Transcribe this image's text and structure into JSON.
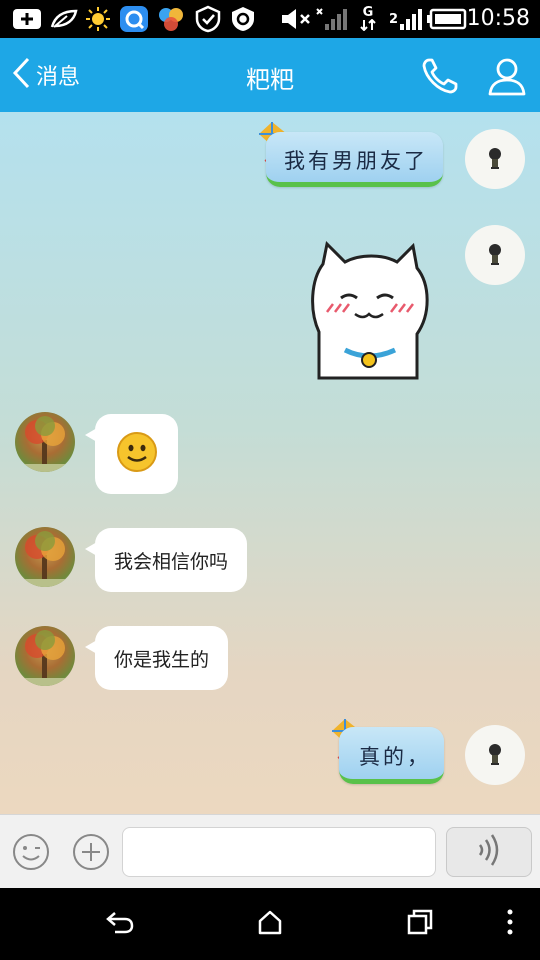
{
  "status_bar": {
    "time": "10:58",
    "network_label": "G",
    "sim_label": "2",
    "icons": [
      "add-icon",
      "leaf-icon",
      "sun-icon",
      "qq-browser-icon",
      "qq-color-icon",
      "shield-icon",
      "settings-shield-icon",
      "volume-mute-icon",
      "signal-icon",
      "data-icon",
      "signal-2-icon",
      "battery-icon"
    ]
  },
  "header": {
    "back_label": "消息",
    "title": "粑粑",
    "icons": {
      "back": "chevron-left-icon",
      "phone": "phone-icon",
      "profile": "person-icon"
    }
  },
  "messages": [
    {
      "side": "right",
      "type": "kite-text",
      "text": "我有男朋友了"
    },
    {
      "side": "right",
      "type": "sticker",
      "sticker": "cat-blush-sticker"
    },
    {
      "side": "left",
      "type": "emoji",
      "emoji": "smile-emoji"
    },
    {
      "side": "left",
      "type": "text",
      "text": "我会相信你吗"
    },
    {
      "side": "left",
      "type": "text",
      "text": "你是我生的"
    },
    {
      "side": "right",
      "type": "kite-text",
      "text": "真的，"
    }
  ],
  "input_bar": {
    "placeholder": "",
    "icons": {
      "emoji": "emoji-icon",
      "plus": "plus-icon",
      "voice": "voice-icon"
    }
  },
  "nav_bar": {
    "icons": [
      "back-icon",
      "home-icon",
      "recents-icon",
      "menu-dots-icon"
    ]
  },
  "colors": {
    "accent": "#1ea7e6",
    "kite_bubble": "#a6d7f2",
    "kite_grass": "#59c14a",
    "bubble_left": "#ffffff"
  }
}
